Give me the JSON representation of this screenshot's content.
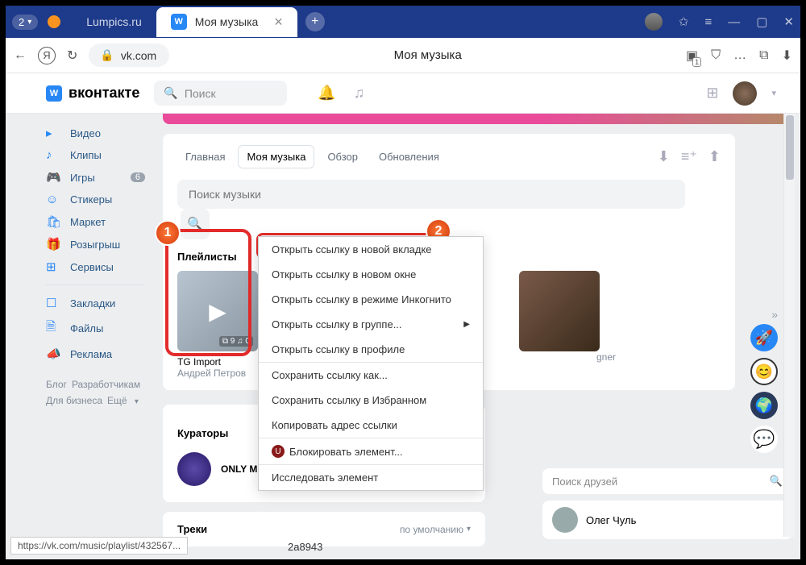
{
  "browser": {
    "tab_counter": "2",
    "inactive_tab": "Lumpics.ru",
    "active_tab": "Моя музыка",
    "url": "vk.com",
    "page_title": "Моя музыка",
    "fav_count": "1"
  },
  "vk": {
    "brand": "вконтакте",
    "search_ph": "Поиск"
  },
  "sidebar": {
    "items": [
      {
        "icon": "▸",
        "label": "Видео"
      },
      {
        "icon": "✄",
        "label": "Клипы"
      },
      {
        "icon": "🎮",
        "label": "Игры",
        "badge": "6"
      },
      {
        "icon": "☺",
        "label": "Стикеры"
      },
      {
        "icon": "🛍",
        "label": "Маркет"
      },
      {
        "icon": "🎁",
        "label": "Розыгрыш"
      },
      {
        "icon": "⊞",
        "label": "Сервисы"
      }
    ],
    "items2": [
      {
        "icon": "☐",
        "label": "Закладки"
      },
      {
        "icon": "🗎",
        "label": "Файлы"
      },
      {
        "icon": "📣",
        "label": "Реклама"
      }
    ],
    "footer": {
      "a": "Блог",
      "b": "Разработчикам",
      "c": "Для бизнеса",
      "d": "Ещё"
    }
  },
  "music": {
    "tabs": {
      "t1": "Главная",
      "t2": "Моя музыка",
      "t3": "Обзор",
      "t4": "Обновления"
    },
    "search_ph": "Поиск музыки",
    "sec_playlists": "Плейлисты",
    "pl1": {
      "title": "TG Import",
      "author": "Андрей Петров",
      "stats": "⧉ 9   ♫ 0"
    },
    "pl2_author": "gner",
    "sec_curators": "Кураторы",
    "curator": "ONLY MUSIC",
    "sec_tracks": "Треки",
    "sort": "по умолчанию",
    "friends_ph": "Поиск друзей",
    "friend_name": "Олег Чуль",
    "track_id": "2a8943"
  },
  "ctx": {
    "i1": "Открыть ссылку в новой вкладке",
    "i2": "Открыть ссылку в новом окне",
    "i3": "Открыть ссылку в режиме Инкогнито",
    "i4": "Открыть ссылку в группе...",
    "i5": "Открыть ссылку в профиле",
    "i6": "Сохранить ссылку как...",
    "i7": "Сохранить ссылку в Избранном",
    "i8": "Копировать адрес ссылки",
    "i9": "Блокировать элемент...",
    "i10": "Исследовать элемент"
  },
  "status": "https://vk.com/music/playlist/432567...",
  "badges": {
    "one": "1",
    "two": "2"
  }
}
